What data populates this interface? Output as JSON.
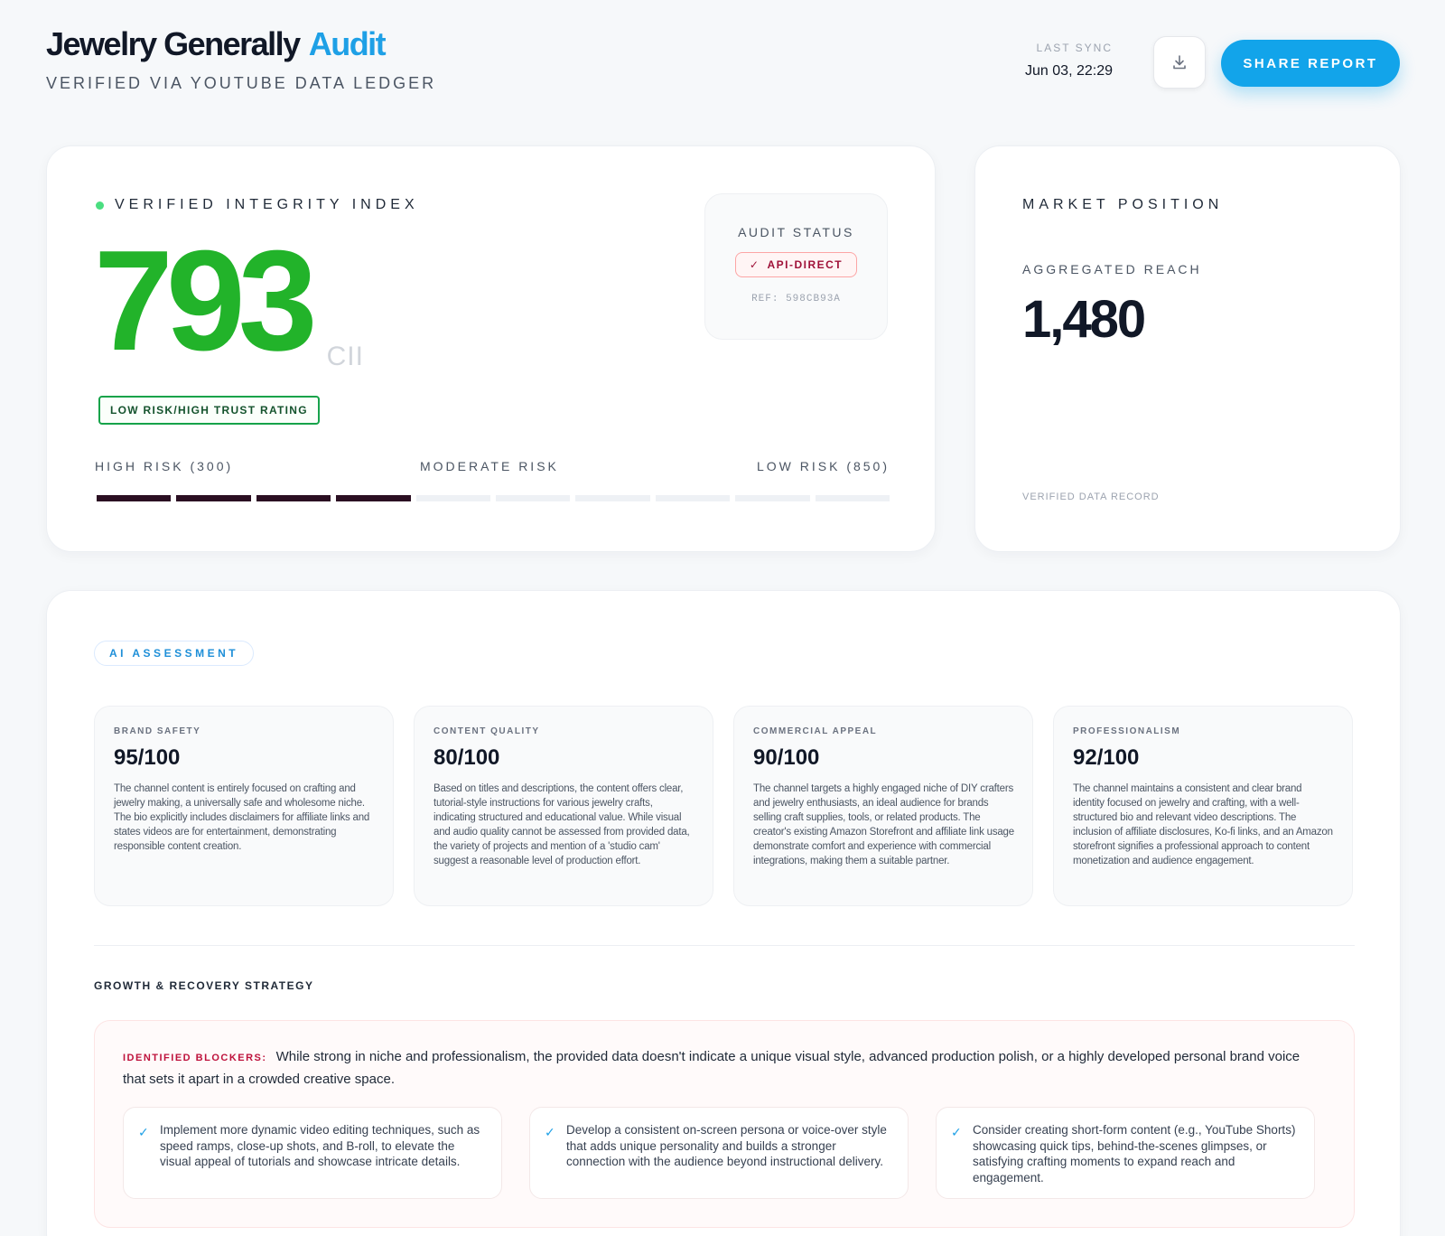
{
  "header": {
    "title_main": "Jewelry Generally",
    "title_accent": "Audit",
    "subtitle": "VERIFIED VIA YOUTUBE DATA LEDGER",
    "sync_label": "LAST SYNC",
    "sync_value": "Jun 03, 22:29",
    "download_icon": "download-icon",
    "share_label": "SHARE REPORT"
  },
  "integrity": {
    "label": "VERIFIED INTEGRITY INDEX",
    "score": "793",
    "unit": "CII",
    "rating": "LOW RISK/HIGH TRUST RATING",
    "risk_low_label": "HIGH RISK (300)",
    "risk_mid_label": "MODERATE RISK",
    "risk_high_label": "LOW RISK (850)",
    "segments_total": 10,
    "segments_filled": 4
  },
  "audit": {
    "label": "AUDIT STATUS",
    "status": "API-DIRECT",
    "ref": "REF: 598CB93A"
  },
  "market": {
    "label": "MARKET POSITION",
    "reach_label": "AGGREGATED REACH",
    "reach_value": "1,480",
    "footer": "VERIFIED DATA RECORD"
  },
  "ai": {
    "pill": "AI ASSESSMENT",
    "metrics": [
      {
        "label": "BRAND SAFETY",
        "score": "95/100",
        "text": "The channel content is entirely focused on crafting and jewelry making, a universally safe and wholesome niche. The bio explicitly includes disclaimers for affiliate links and states videos are for entertainment, demonstrating responsible content creation."
      },
      {
        "label": "CONTENT QUALITY",
        "score": "80/100",
        "text": "Based on titles and descriptions, the content offers clear, tutorial-style instructions for various jewelry crafts, indicating structured and educational value. While visual and audio quality cannot be assessed from provided data, the variety of projects and mention of a 'studio cam' suggest a reasonable level of production effort."
      },
      {
        "label": "COMMERCIAL APPEAL",
        "score": "90/100",
        "text": "The channel targets a highly engaged niche of DIY crafters and jewelry enthusiasts, an ideal audience for brands selling craft supplies, tools, or related products. The creator's existing Amazon Storefront and affiliate link usage demonstrate comfort and experience with commercial integrations, making them a suitable partner."
      },
      {
        "label": "PROFESSIONALISM",
        "score": "92/100",
        "text": "The channel maintains a consistent and clear brand identity focused on jewelry and crafting, with a well-structured bio and relevant video descriptions. The inclusion of affiliate disclosures, Ko-fi links, and an Amazon storefront signifies a professional approach to content monetization and audience engagement."
      }
    ],
    "strategy_title": "GROWTH & RECOVERY STRATEGY",
    "blocker_label": "IDENTIFIED BLOCKERS:",
    "blocker_text": "While strong in niche and professionalism, the provided data doesn't indicate a unique visual style, advanced production polish, or a highly developed personal brand voice that sets it apart in a crowded creative space.",
    "actions": [
      "Implement more dynamic video editing techniques, such as speed ramps, close-up shots, and B-roll, to elevate the visual appeal of tutorials and showcase intricate details.",
      "Develop a consistent on-screen persona or voice-over style that adds unique personality and builds a stronger connection with the audience beyond instructional delivery.",
      "Consider creating short-form content (e.g., YouTube Shorts) showcasing quick tips, behind-the-scenes glimpses, or satisfying crafting moments to expand reach and engagement."
    ]
  },
  "colors": {
    "accent_blue": "#12a4ea",
    "score_green": "#22b32a",
    "risk_fill": "#2b0f22",
    "blocker_red": "#be123c"
  }
}
